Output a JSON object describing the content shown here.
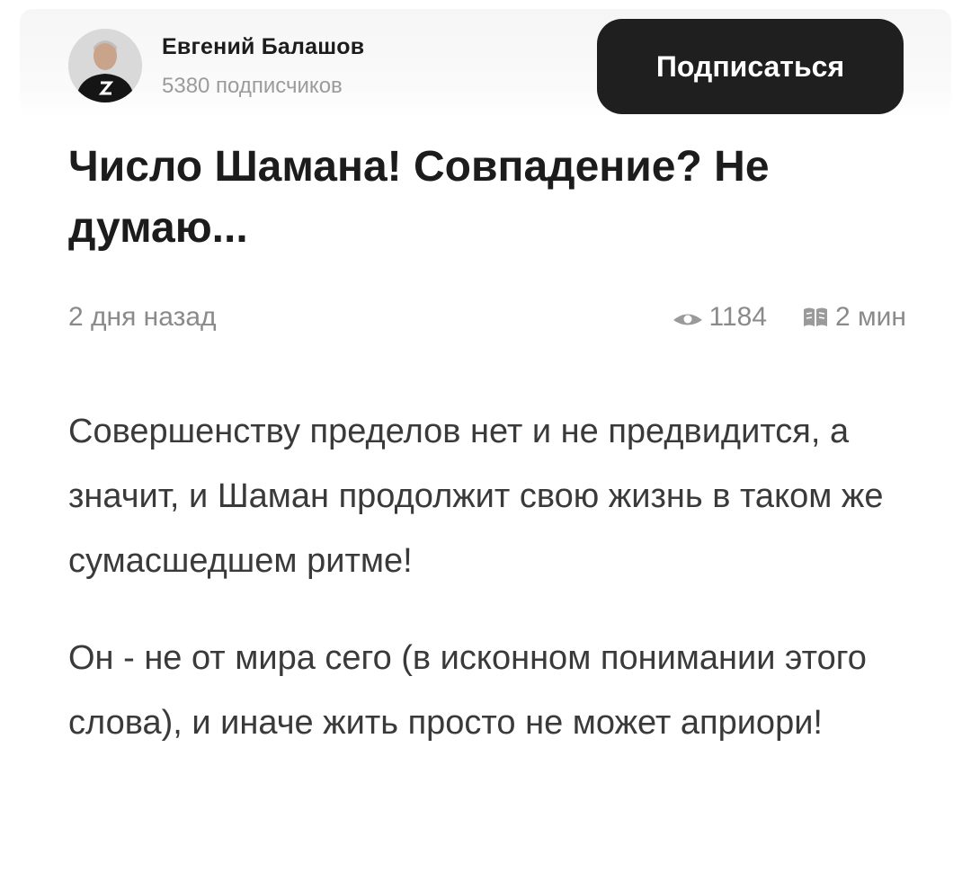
{
  "author": {
    "name": "Евгений Балашов",
    "subscribers": "5380 подписчиков",
    "subscribe_label": "Подписаться"
  },
  "article": {
    "title": "Число Шамана! Совпадение? Не думаю...",
    "date": "2 дня назад",
    "views": "1184",
    "read_time": "2 мин",
    "paragraphs": [
      "Совершенству пределов нет и не предвидится, а значит, и Шаман продолжит свою жизнь в таком же сумасшедшем ритме!",
      "Он - не от мира сего (в исконном понимании этого слова), и иначе жить просто не может априори!"
    ]
  },
  "icons": {
    "views": "eye-icon",
    "read_time": "book-icon"
  },
  "colors": {
    "button_bg": "#1f1f1f",
    "muted_text": "#8a8a8a",
    "body_text": "#3a3a3a"
  }
}
